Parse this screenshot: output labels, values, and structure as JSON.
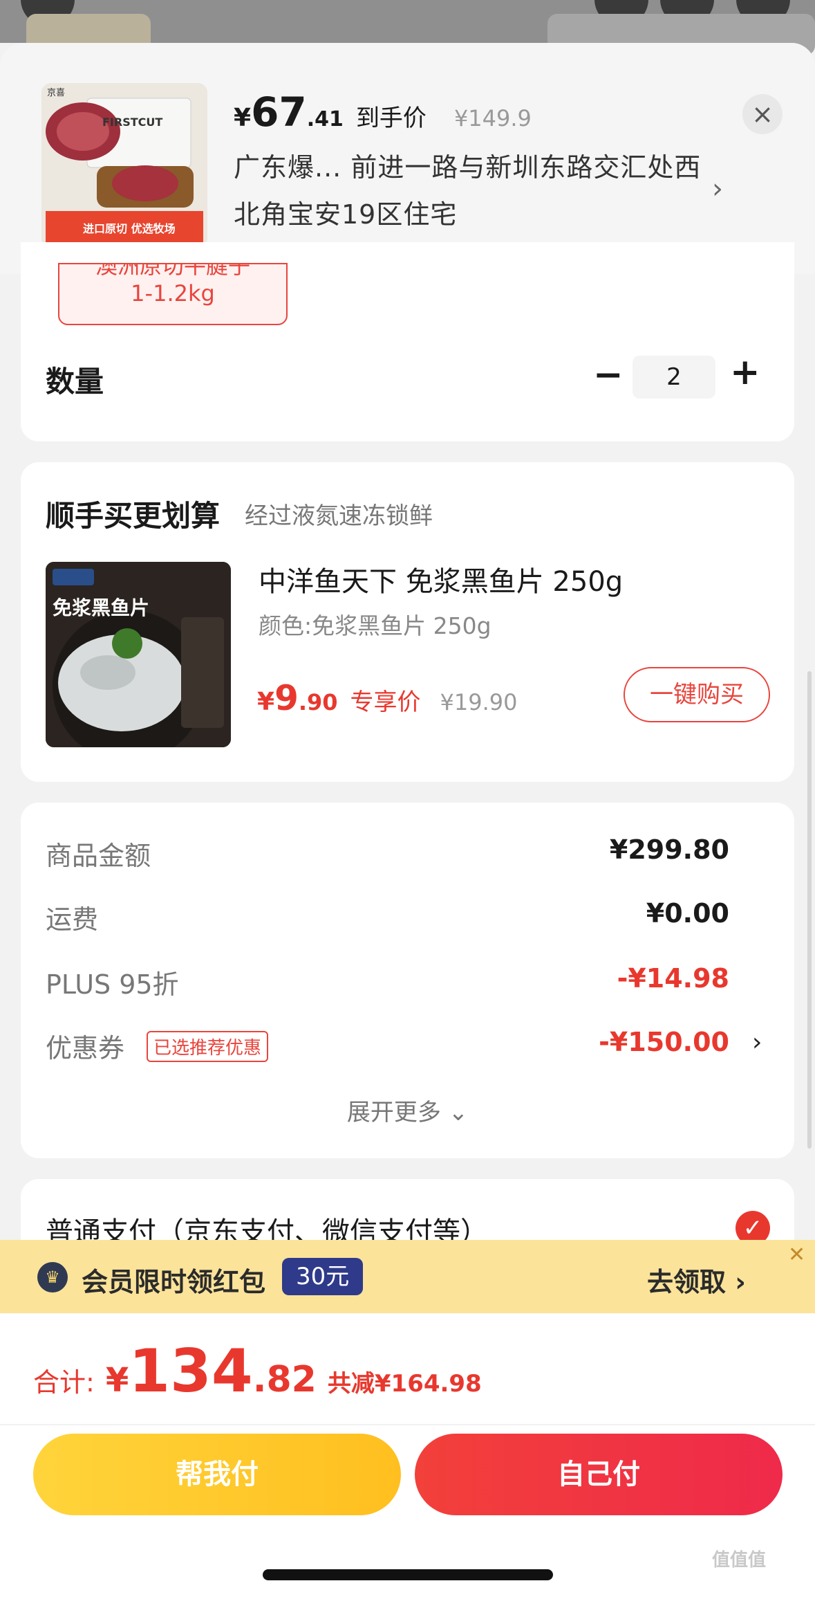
{
  "header": {
    "price_currency": "¥",
    "price_int": "67",
    "price_dec": ".41",
    "price_tag": "到手价",
    "original_price": "¥149.9",
    "address": "广东爆... 前进一路与新圳东路交汇处西北角宝安19区住宅",
    "thumb_logo": "京喜",
    "thumb_brand": "FIRSTCUT",
    "thumb_banner": "进口原切 优选牧场"
  },
  "spec": {
    "chip_line1": "澳洲原切牛腱子",
    "chip_line2": "1-1.2kg"
  },
  "quantity": {
    "label": "数量",
    "value": "2"
  },
  "addon": {
    "title": "顺手买更划算",
    "subtitle": "经过液氮速冻锁鲜",
    "product_name": "中洋鱼天下 免浆黑鱼片 250g",
    "color_line": "颜色:免浆黑鱼片 250g",
    "price_yen": "¥",
    "price_int": "9",
    "price_dec": ".90",
    "price_tag": "专享价",
    "original_price": "¥19.90",
    "buy_label": "一键购买",
    "img_text": "免浆黑鱼片"
  },
  "summary": {
    "rows": [
      {
        "label": "商品金额",
        "value": "¥299.80"
      },
      {
        "label": "运费",
        "value": "¥0.00"
      },
      {
        "label": "PLUS 95折",
        "value": "-¥14.98"
      },
      {
        "label": "优惠券",
        "value": "-¥150.00"
      }
    ],
    "coupon_tag": "已选推荐优惠",
    "expand_label": "展开更多 ⌄"
  },
  "payment": {
    "label": "普通支付（京东支付、微信支付等）"
  },
  "banner": {
    "text": "会员限时领红包",
    "pill": "30元",
    "action": "去领取 ›"
  },
  "footer": {
    "total_label": "合计:",
    "total_yen": "¥",
    "total_int": "134",
    "total_dec": ".82",
    "total_save": "共减¥164.98",
    "help_pay": "帮我付",
    "self_pay": "自己付"
  },
  "watermark": "值值值",
  "colors": {
    "accent_red": "#e8382e",
    "banner_yellow": "#fbe39a",
    "help_btn": "#ffc82a",
    "self_btn": "#ef2a4a"
  }
}
